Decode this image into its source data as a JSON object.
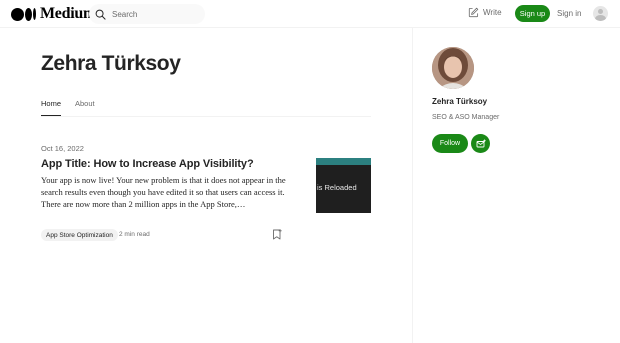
{
  "header": {
    "logo_text": "Medium",
    "search_placeholder": "Search",
    "write_label": "Write",
    "signup_label": "Sign up",
    "signin_label": "Sign in"
  },
  "author": {
    "name": "Zehra Türksoy",
    "role": "SEO & ASO Manager"
  },
  "tabs": [
    {
      "label": "Home",
      "active": true
    },
    {
      "label": "About",
      "active": false
    }
  ],
  "post": {
    "date": "Oct 16, 2022",
    "title": "App Title: How to Increase App Visibility?",
    "excerpt": "Your app is now live! Your new problem is that it does not appear in the search results even though you have edited it so that users can access it. There are now more than 2 million apps in the App Store,…",
    "thumbnail_text": "is Reloaded",
    "tag": "App Store Optimization",
    "read_time": "2 min read"
  },
  "sidebar": {
    "follow_label": "Follow"
  },
  "colors": {
    "accent": "#1a8917",
    "text": "#242424",
    "muted": "#6b6b6b"
  },
  "icons": [
    "search-icon",
    "write-icon",
    "bookmark-icon",
    "subscribe-icon",
    "avatar-placeholder-icon"
  ]
}
